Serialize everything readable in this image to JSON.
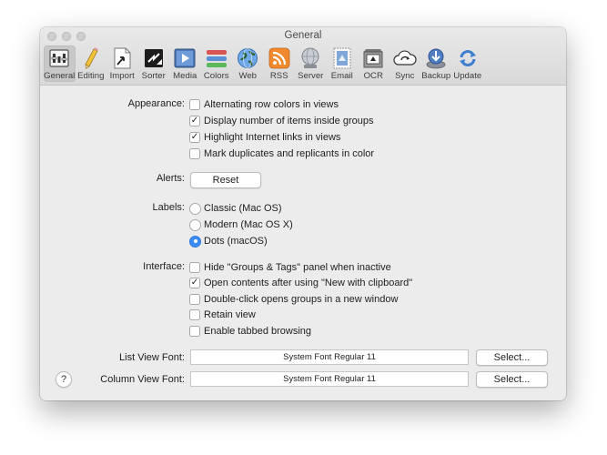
{
  "window": {
    "title": "General"
  },
  "toolbar": {
    "items": [
      {
        "label": "General",
        "icon": "general-panel-icon",
        "selected": true
      },
      {
        "label": "Editing",
        "icon": "pencil-icon"
      },
      {
        "label": "Import",
        "icon": "import-document-icon"
      },
      {
        "label": "Sorter",
        "icon": "sorter-icon"
      },
      {
        "label": "Media",
        "icon": "media-play-icon"
      },
      {
        "label": "Colors",
        "icon": "colors-stripes-icon"
      },
      {
        "label": "Web",
        "icon": "globe-icon"
      },
      {
        "label": "RSS",
        "icon": "rss-icon"
      },
      {
        "label": "Server",
        "icon": "server-icon"
      },
      {
        "label": "Email",
        "icon": "email-stamp-icon"
      },
      {
        "label": "OCR",
        "icon": "ocr-scanner-icon"
      },
      {
        "label": "Sync",
        "icon": "sync-cloud-icon"
      },
      {
        "label": "Backup",
        "icon": "backup-drive-icon"
      },
      {
        "label": "Update",
        "icon": "update-arrows-icon"
      }
    ]
  },
  "appearance": {
    "label": "Appearance:",
    "options": [
      {
        "text": "Alternating row colors in views",
        "checked": false
      },
      {
        "text": "Display number of items inside groups",
        "checked": true
      },
      {
        "text": "Highlight Internet links in views",
        "checked": true
      },
      {
        "text": "Mark duplicates and replicants in color",
        "checked": false
      }
    ]
  },
  "alerts": {
    "label": "Alerts:",
    "button": "Reset"
  },
  "labels": {
    "label": "Labels:",
    "options": [
      {
        "text": "Classic (Mac OS)",
        "selected": false
      },
      {
        "text": "Modern (Mac OS X)",
        "selected": false
      },
      {
        "text": "Dots (macOS)",
        "selected": true
      }
    ]
  },
  "interface": {
    "label": "Interface:",
    "options": [
      {
        "text": "Hide \"Groups & Tags\" panel when inactive",
        "checked": false
      },
      {
        "text": "Open contents after using \"New with clipboard\"",
        "checked": true
      },
      {
        "text": "Double-click opens groups in a new window",
        "checked": false
      },
      {
        "text": "Retain view",
        "checked": false
      },
      {
        "text": "Enable tabbed browsing",
        "checked": false
      }
    ]
  },
  "fonts": {
    "list": {
      "label": "List View Font:",
      "value": "System Font Regular 11",
      "button": "Select..."
    },
    "column": {
      "label": "Column View Font:",
      "value": "System Font Regular 11",
      "button": "Select..."
    }
  },
  "help": {
    "label": "?"
  },
  "colors": {
    "accent": "#3b8cf6",
    "window_bg": "#ececec",
    "titlebar": "#dcdcdc"
  }
}
